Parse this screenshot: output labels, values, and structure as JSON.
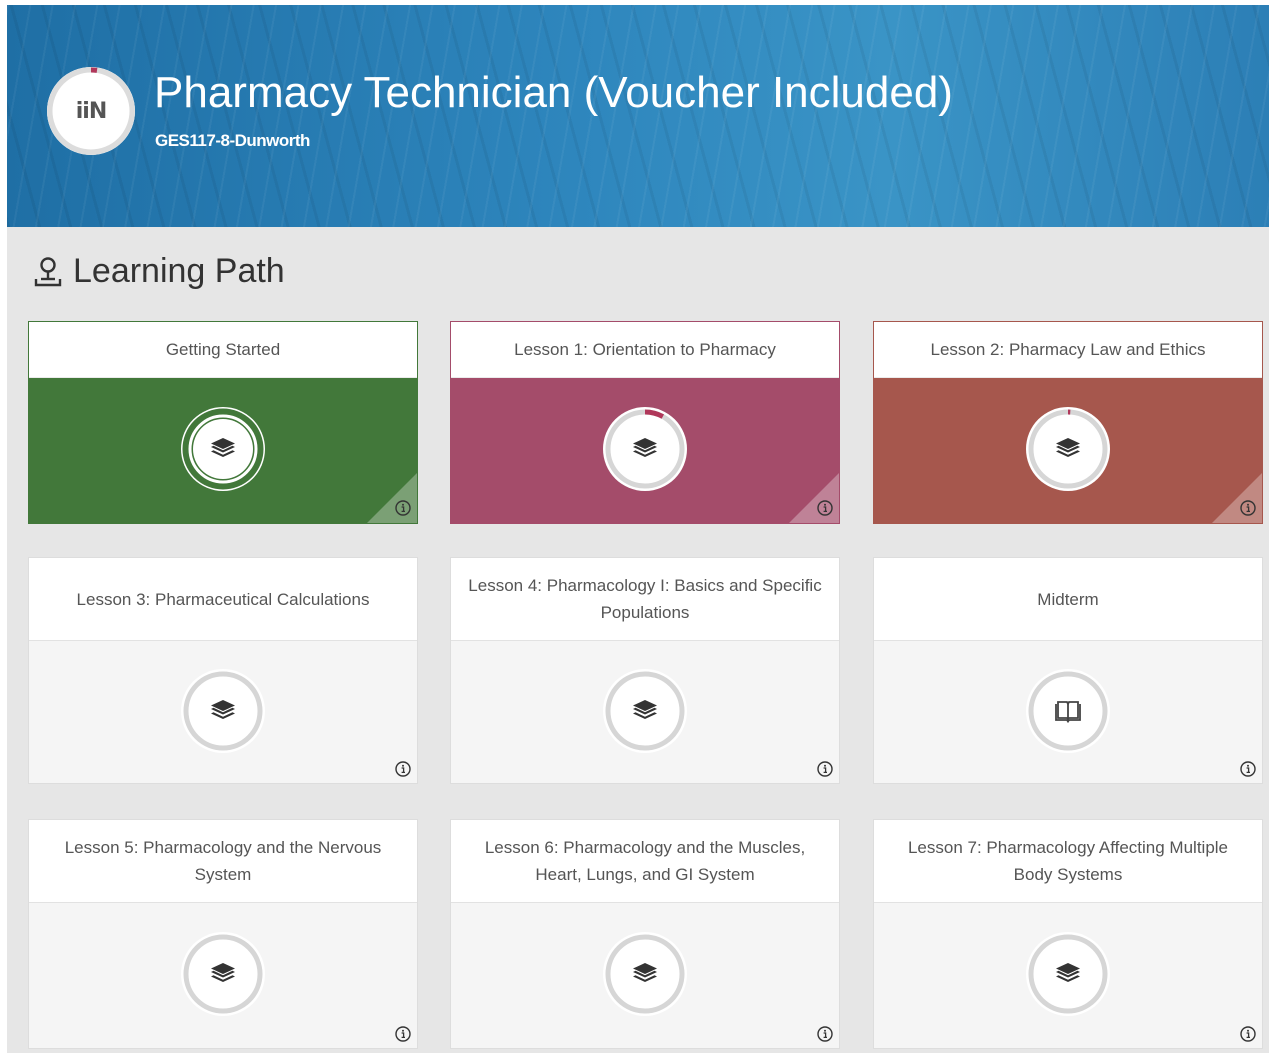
{
  "course": {
    "title": "Pharmacy Technician (Voucher Included)",
    "code": "GES117-8-Dunworth",
    "logo_text": "iiN"
  },
  "section": {
    "title": "Learning Path",
    "icon": "map-pin-icon"
  },
  "cards": [
    {
      "title": "Getting Started",
      "status": "completed",
      "color": "#42783a",
      "icon": "layers-icon",
      "progress": 1.0
    },
    {
      "title": "Lesson 1: Orientation to Pharmacy",
      "status": "in-progress",
      "color": "#a44c6a",
      "icon": "layers-icon",
      "progress": 0.08
    },
    {
      "title": "Lesson 2: Pharmacy Law and Ethics",
      "status": "in-progress",
      "color": "#a6574d",
      "icon": "layers-icon",
      "progress": 0.01
    },
    {
      "title": "Lesson 3: Pharmaceutical Calculations",
      "status": "not-started",
      "icon": "layers-icon",
      "progress": 0
    },
    {
      "title": "Lesson 4: Pharmacology I: Basics and Specific Populations",
      "status": "not-started",
      "icon": "layers-icon",
      "progress": 0
    },
    {
      "title": "Midterm",
      "status": "not-started",
      "icon": "book-icon",
      "progress": 0
    },
    {
      "title": "Lesson 5: Pharmacology and the Nervous System",
      "status": "not-started",
      "icon": "layers-icon",
      "progress": 0
    },
    {
      "title": "Lesson 6: Pharmacology and the Muscles, Heart, Lungs, and GI System",
      "status": "not-started",
      "icon": "layers-icon",
      "progress": 0
    },
    {
      "title": "Lesson 7: Pharmacology Affecting Multiple Body Systems",
      "status": "not-started",
      "icon": "layers-icon",
      "progress": 0
    }
  ],
  "colors": {
    "progress_red": "#b0375a",
    "ring_grey": "#d6d6d6",
    "completed_green": "#42783a"
  }
}
